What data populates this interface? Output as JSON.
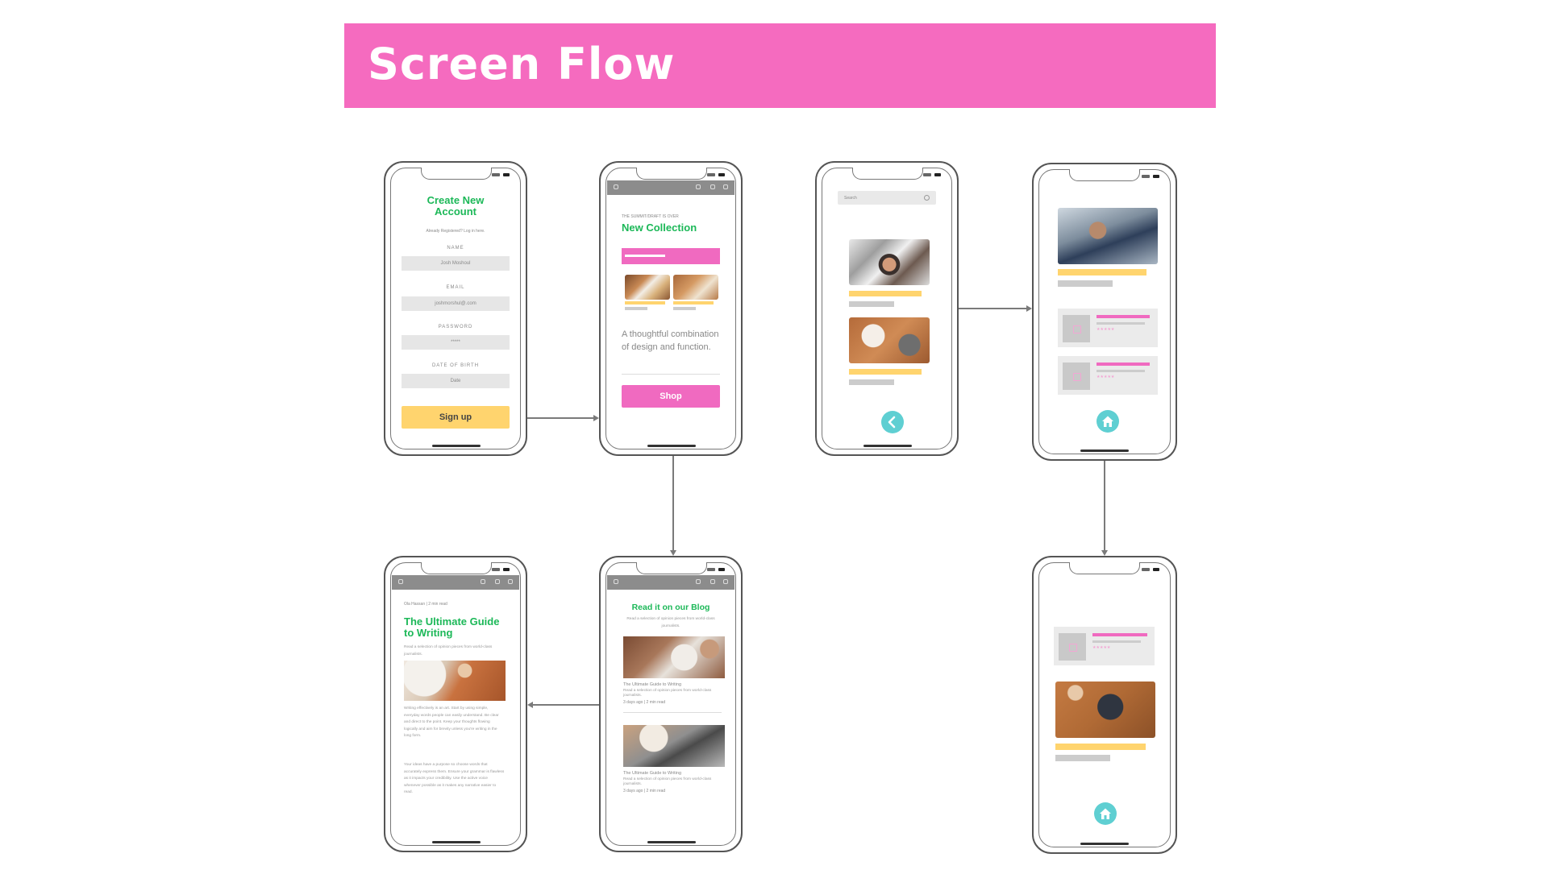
{
  "title": "Screen Flow",
  "colors": {
    "banner": "#f56bbf",
    "green": "#1cb858",
    "pink": "#f06ac0",
    "yellow": "#ffd46e",
    "teal": "#5fcfd2"
  },
  "signup": {
    "title": "Create New Account",
    "subtitle": "Already Registered? Log in here.",
    "name_label": "NAME",
    "name_value": "Josh Moshoul",
    "email_label": "EMAIL",
    "email_value": "joshmorshul@.com",
    "password_label": "PASSWORD",
    "password_value": "*****",
    "dob_label": "DATE OF BIRTH",
    "dob_value": "Date",
    "button": "Sign up"
  },
  "collection": {
    "kicker": "THE SUMMIT/DRAFT IS OVER",
    "title": "New Collection",
    "tagline": "A thoughtful combination of design and function.",
    "button": "Shop"
  },
  "search": {
    "placeholder": "Search",
    "back_icon": "chevron-left-icon"
  },
  "home_a": {
    "home_icon": "home-icon",
    "rating": "★★★★★"
  },
  "home_b": {
    "home_icon": "home-icon",
    "rating": "★★★★★"
  },
  "article": {
    "kicker": "Ola Hassan | 2 min read",
    "title": "The Ultimate Guide to Writing",
    "subtitle": "Read a selection of opinion pieces from world-class journalists.",
    "body1": "Writing effectively is an art. Start by using simple, everyday words people can easily understand. Be clear and direct to the point. Keep your thoughts flowing logically and aim for brevity unless you're writing in the long form.",
    "body2": "Your ideas have a purpose so choose words that accurately express them. Ensure your grammar is flawless as it impacts your credibility. Use the active voice whenever possible as it makes any narrative easier to read."
  },
  "blog": {
    "title": "Read it on our Blog",
    "subtitle": "Read a selection of opinion pieces from world-class journalists.",
    "posts": [
      {
        "title": "The Ultimate Guide to Writing",
        "desc": "Read a selection of opinion pieces from world-class journalists.",
        "meta": "3 days ago | 2 min read"
      },
      {
        "title": "The Ultimate Guide to Writing",
        "desc": "Read a selection of opinion pieces from world-class journalists.",
        "meta": "3 days ago | 2 min read"
      }
    ]
  }
}
